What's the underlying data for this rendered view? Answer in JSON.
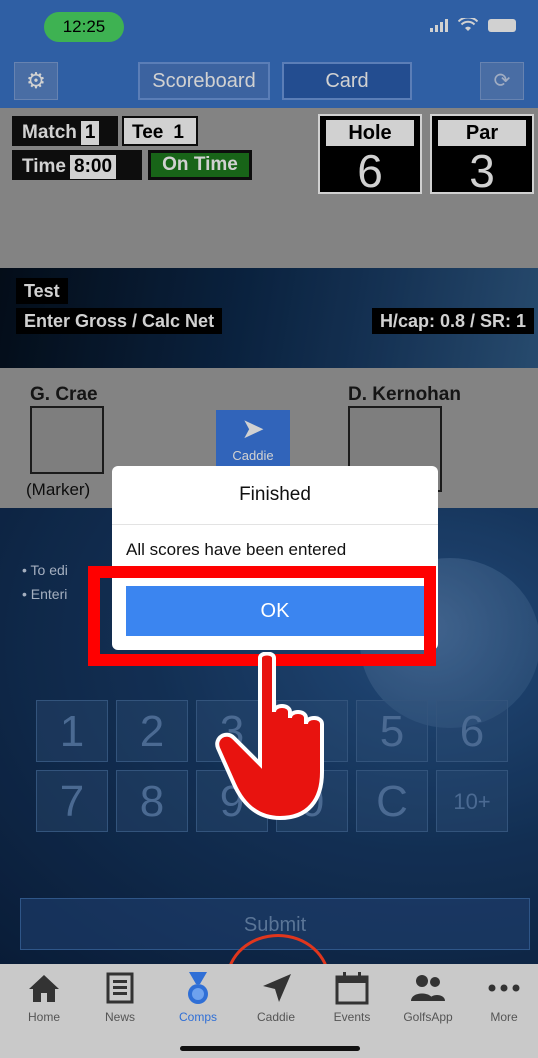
{
  "status_bar": {
    "time": "12:25"
  },
  "toolbar": {
    "scoreboard_label": "Scoreboard",
    "card_label": "Card"
  },
  "info": {
    "match_label": "Match",
    "match_value": "1",
    "tee_label": "Tee",
    "tee_value": "1",
    "time_label": "Time",
    "time_value": "8:00",
    "status": "On Time",
    "hole_label": "Hole",
    "hole_value": "6",
    "par_label": "Par",
    "par_value": "3"
  },
  "banner": {
    "title": "Test",
    "mode": "Enter Gross / Calc Net",
    "hcap": "H/cap: 0.8 / SR: 1"
  },
  "players": {
    "player1": "G. Crae",
    "player2": "D. Kernohan",
    "marker": "(Marker)",
    "caddie_label": "Caddie"
  },
  "hints": [
    "To edi",
    "Enteri"
  ],
  "keypad": {
    "row1": [
      "1",
      "2",
      "3",
      "4",
      "5",
      "6"
    ],
    "row2": [
      "7",
      "8",
      "9",
      "0",
      "C",
      "10+"
    ]
  },
  "submit_label": "Submit",
  "dialog": {
    "title": "Finished",
    "message": "All scores have been entered",
    "ok_label": "OK"
  },
  "tabs": [
    {
      "label": "Home",
      "icon": "home-icon"
    },
    {
      "label": "News",
      "icon": "news-icon"
    },
    {
      "label": "Comps",
      "icon": "medal-icon"
    },
    {
      "label": "Caddie",
      "icon": "navigation-arrow-icon"
    },
    {
      "label": "Events",
      "icon": "calendar-icon"
    },
    {
      "label": "GolfsApp",
      "icon": "people-icon"
    },
    {
      "label": "More",
      "icon": "more-icon"
    }
  ],
  "colors": {
    "accent": "#3a74c9",
    "highlight": "#ff0000",
    "ok_button": "#3b85f0",
    "on_time": "#1e7a1e"
  }
}
